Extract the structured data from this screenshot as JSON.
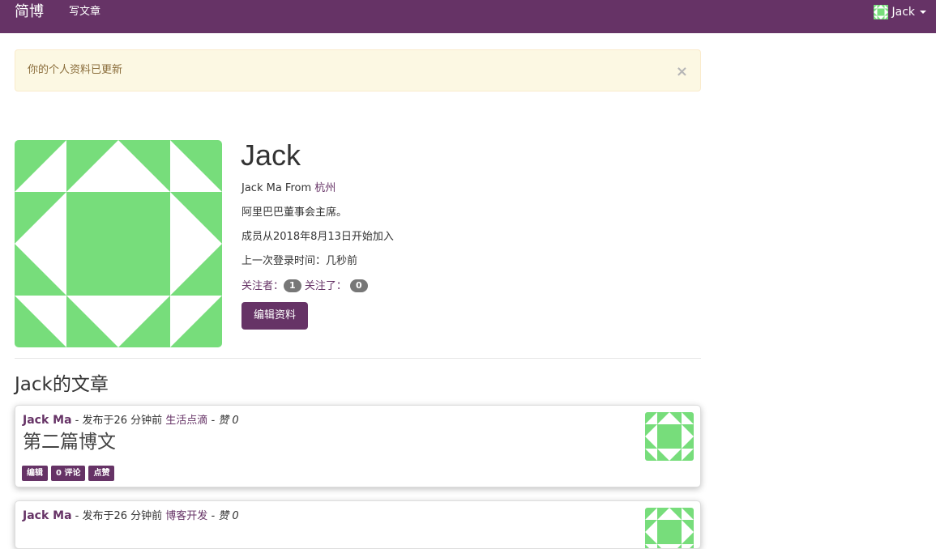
{
  "navbar": {
    "brand": "简博",
    "write_link": "写文章",
    "user_name": "Jack"
  },
  "alert": {
    "message": "你的个人资料已更新",
    "close_symbol": "×"
  },
  "profile": {
    "name": "Jack",
    "fullname_prefix": "Jack Ma From ",
    "city": "杭州",
    "bio": "阿里巴巴董事会主席。",
    "member_since": "成员从2018年8月13日开始加入",
    "last_login": "上一次登录时间：几秒前",
    "followers_label": "关注者：",
    "followers_count": "1",
    "following_label": "关注了：",
    "following_count": "0",
    "edit_button": "编辑资料"
  },
  "posts_section": {
    "title": "Jack的文章"
  },
  "posts": [
    {
      "author": "Jack Ma",
      "published": " - 发布于26 分钟前 ",
      "category": "生活点滴",
      "likes": " - 赞 0",
      "title": "第二篇博文",
      "tags": [
        "编辑",
        "0 评论",
        "点赞"
      ]
    },
    {
      "author": "Jack Ma",
      "published": " - 发布于26 分钟前 ",
      "category": "博客开发",
      "likes": " - 赞 0",
      "title": "",
      "tags": []
    }
  ],
  "colors": {
    "brand": "#663366",
    "avatar_green": "#77dd7b",
    "alert_bg": "#fcf8e3",
    "alert_text": "#8a6d3b"
  },
  "icons": {
    "avatar": "identicon-green-pattern",
    "caret": "caret-down-icon",
    "close": "close-icon"
  }
}
